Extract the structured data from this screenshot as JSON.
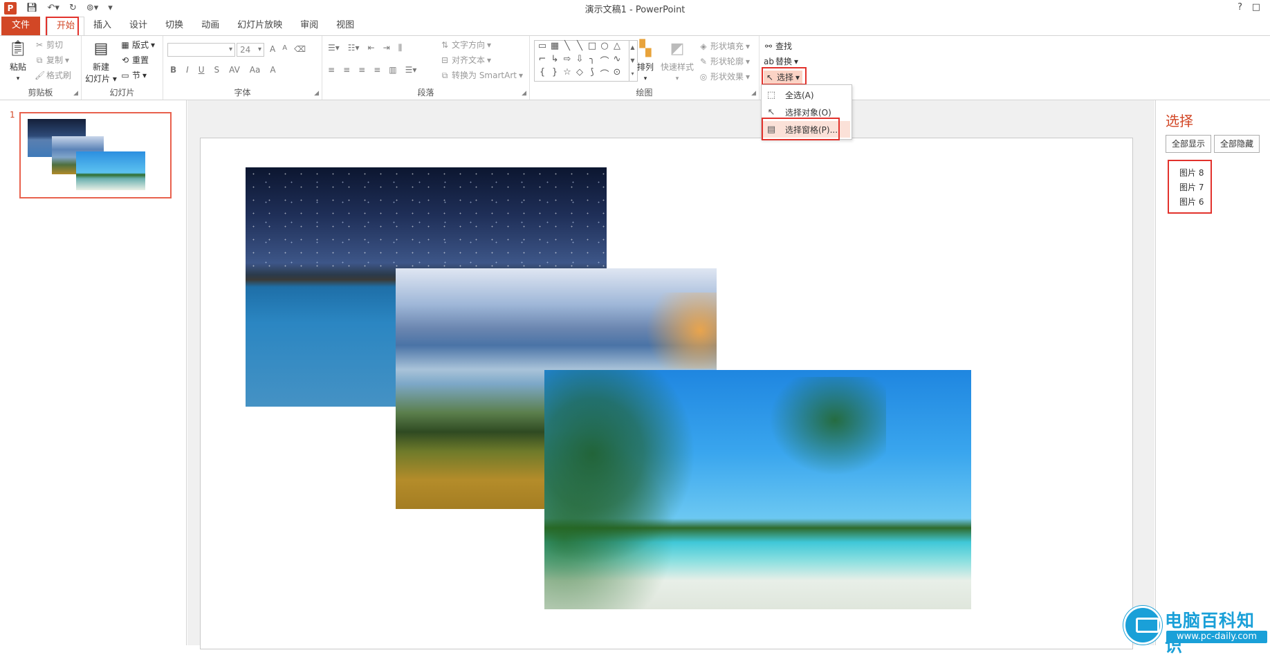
{
  "window": {
    "title": "演示文稿1 - PowerPoint",
    "help": "?",
    "restore": "□"
  },
  "qat": {
    "app_icon": "P",
    "save_icon": "save-icon",
    "undo_icon": "undo-icon",
    "redo_icon": "redo-icon",
    "present_icon": "present-icon",
    "customize_icon": "customize-icon"
  },
  "tabs": [
    "文件",
    "开始",
    "插入",
    "设计",
    "切换",
    "动画",
    "幻灯片放映",
    "审阅",
    "视图"
  ],
  "active_tab": "开始",
  "ribbon": {
    "clipboard": {
      "paste": "粘贴",
      "cut": "剪切",
      "copy": "复制",
      "format_painter": "格式刷",
      "label": "剪贴板"
    },
    "slides": {
      "new_slide_line1": "新建",
      "new_slide_line2": "幻灯片",
      "layout": "版式",
      "reset": "重置",
      "section": "节",
      "label": "幻灯片"
    },
    "font": {
      "font_name": "",
      "font_size": "24",
      "label": "字体",
      "buttons_row1": [
        "A",
        "A",
        "A"
      ],
      "buttons_row2": [
        "B",
        "I",
        "U",
        "S",
        "AV",
        "Aa",
        "A"
      ]
    },
    "paragraph": {
      "text_direction": "文字方向",
      "align_text": "对齐文本",
      "convert_smartart": "转换为 SmartArt",
      "label": "段落"
    },
    "drawing": {
      "arrange": "排列",
      "quick_styles": "快速样式",
      "shape_fill": "形状填充",
      "shape_outline": "形状轮廓",
      "shape_effects": "形状效果",
      "label": "绘图",
      "shapes": [
        "▭",
        "▦",
        "╲",
        "╲",
        "□",
        "○",
        "△",
        "⌐",
        "↳",
        "⇨",
        "⇩",
        "╮",
        "⌒",
        "∿",
        "{",
        "}",
        "☆",
        "◇",
        "⟆",
        "⌒",
        "⊙"
      ]
    },
    "editing": {
      "find": "查找",
      "replace": "替换",
      "select": "选择"
    }
  },
  "select_menu": {
    "items": [
      {
        "label": "全选(A)",
        "icon": "select-all-icon",
        "glyph": "⬚"
      },
      {
        "label": "选择对象(O)",
        "icon": "select-objects-icon",
        "glyph": "↖"
      },
      {
        "label": "选择窗格(P)...",
        "icon": "selection-pane-icon",
        "glyph": "▤"
      }
    ]
  },
  "slides_pane": {
    "slide_number": "1"
  },
  "selection_pane": {
    "title": "选择",
    "show_all": "全部显示",
    "hide_all": "全部隐藏",
    "items": [
      "图片 8",
      "图片 7",
      "图片 6"
    ]
  },
  "watermark": {
    "title": "电脑百科知识",
    "url": "www.pc-daily.com"
  },
  "colors": {
    "accent": "#d24726",
    "highlight_box": "#e2312b",
    "menu_hover": "#fbe1d8",
    "watermark": "#1aa0d8"
  }
}
